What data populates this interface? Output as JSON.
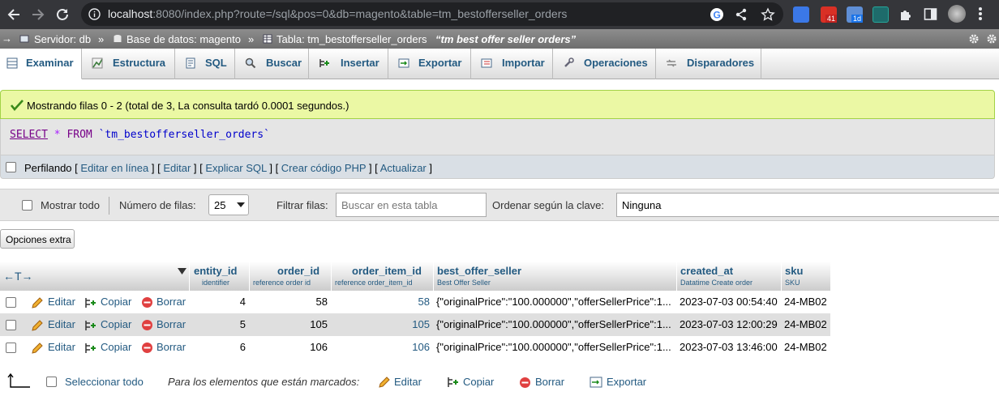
{
  "browser": {
    "url_host": "localhost",
    "url_rest": ":8080/index.php?route=/sql&pos=0&db=magento&table=tm_bestofferseller_orders",
    "badge_mail": "41",
    "badge_cal": "1d"
  },
  "breadcrumb": {
    "server": "Servidor: db",
    "sep1": "»",
    "database": "Base de datos: magento",
    "sep2": "»",
    "table": "Tabla: tm_bestofferseller_orders",
    "comment": "“tm best offer seller orders”"
  },
  "tabs": [
    {
      "label": "Examinar"
    },
    {
      "label": "Estructura"
    },
    {
      "label": "SQL"
    },
    {
      "label": "Buscar"
    },
    {
      "label": "Insertar"
    },
    {
      "label": "Exportar"
    },
    {
      "label": "Importar"
    },
    {
      "label": "Operaciones"
    },
    {
      "label": "Disparadores"
    }
  ],
  "result": {
    "message": "Mostrando filas 0 - 2 (total de 3, La consulta tardó 0.0001 segundos.)",
    "sql_select": "SELECT",
    "sql_star": "*",
    "sql_from": "FROM",
    "sql_table": "`tm_bestofferseller_orders`"
  },
  "toolbox": {
    "profiling": "Perfilando",
    "edit_inline": "Editar en línea",
    "edit": "Editar",
    "explain": "Explicar SQL",
    "php": "Crear código PHP",
    "refresh": "Actualizar"
  },
  "nav": {
    "show_all": "Mostrar todo",
    "rows_label": "Número de filas:",
    "rows_value": "25",
    "filter_label": "Filtrar filas:",
    "filter_placeholder": "Buscar en esta tabla",
    "sort_label": "Ordenar según la clave:",
    "sort_value": "Ninguna",
    "extra_options": "Opciones extra"
  },
  "table": {
    "columns": [
      {
        "name": "entity_id",
        "comment": "identifier"
      },
      {
        "name": "order_id",
        "comment": "reference order id"
      },
      {
        "name": "order_item_id",
        "comment": "reference order_item_id"
      },
      {
        "name": "best_offer_seller",
        "comment": "Best Offer Seller"
      },
      {
        "name": "created_at",
        "comment": "Datatime Create order"
      },
      {
        "name": "sku",
        "comment": "SKU"
      }
    ],
    "actions": {
      "edit": "Editar",
      "copy": "Copiar",
      "delete": "Borrar"
    },
    "rows": [
      {
        "entity_id": "4",
        "order_id": "58",
        "order_item_id": "58",
        "best_offer_seller": "{\"originalPrice\":\"100.000000\",\"offerSellerPrice\":1...",
        "created_at": "2023-07-03 00:54:40",
        "sku": "24-MB02"
      },
      {
        "entity_id": "5",
        "order_id": "105",
        "order_item_id": "105",
        "best_offer_seller": "{\"originalPrice\":\"100.000000\",\"offerSellerPrice\":1...",
        "created_at": "2023-07-03 12:00:29",
        "sku": "24-MB02"
      },
      {
        "entity_id": "6",
        "order_id": "106",
        "order_item_id": "106",
        "best_offer_seller": "{\"originalPrice\":\"100.000000\",\"offerSellerPrice\":1...",
        "created_at": "2023-07-03 13:46:00",
        "sku": "24-MB02"
      }
    ]
  },
  "bulk": {
    "select_all": "Seleccionar todo",
    "with_selected": "Para los elementos que están marcados:",
    "edit": "Editar",
    "copy": "Copiar",
    "delete": "Borrar",
    "export": "Exportar"
  }
}
